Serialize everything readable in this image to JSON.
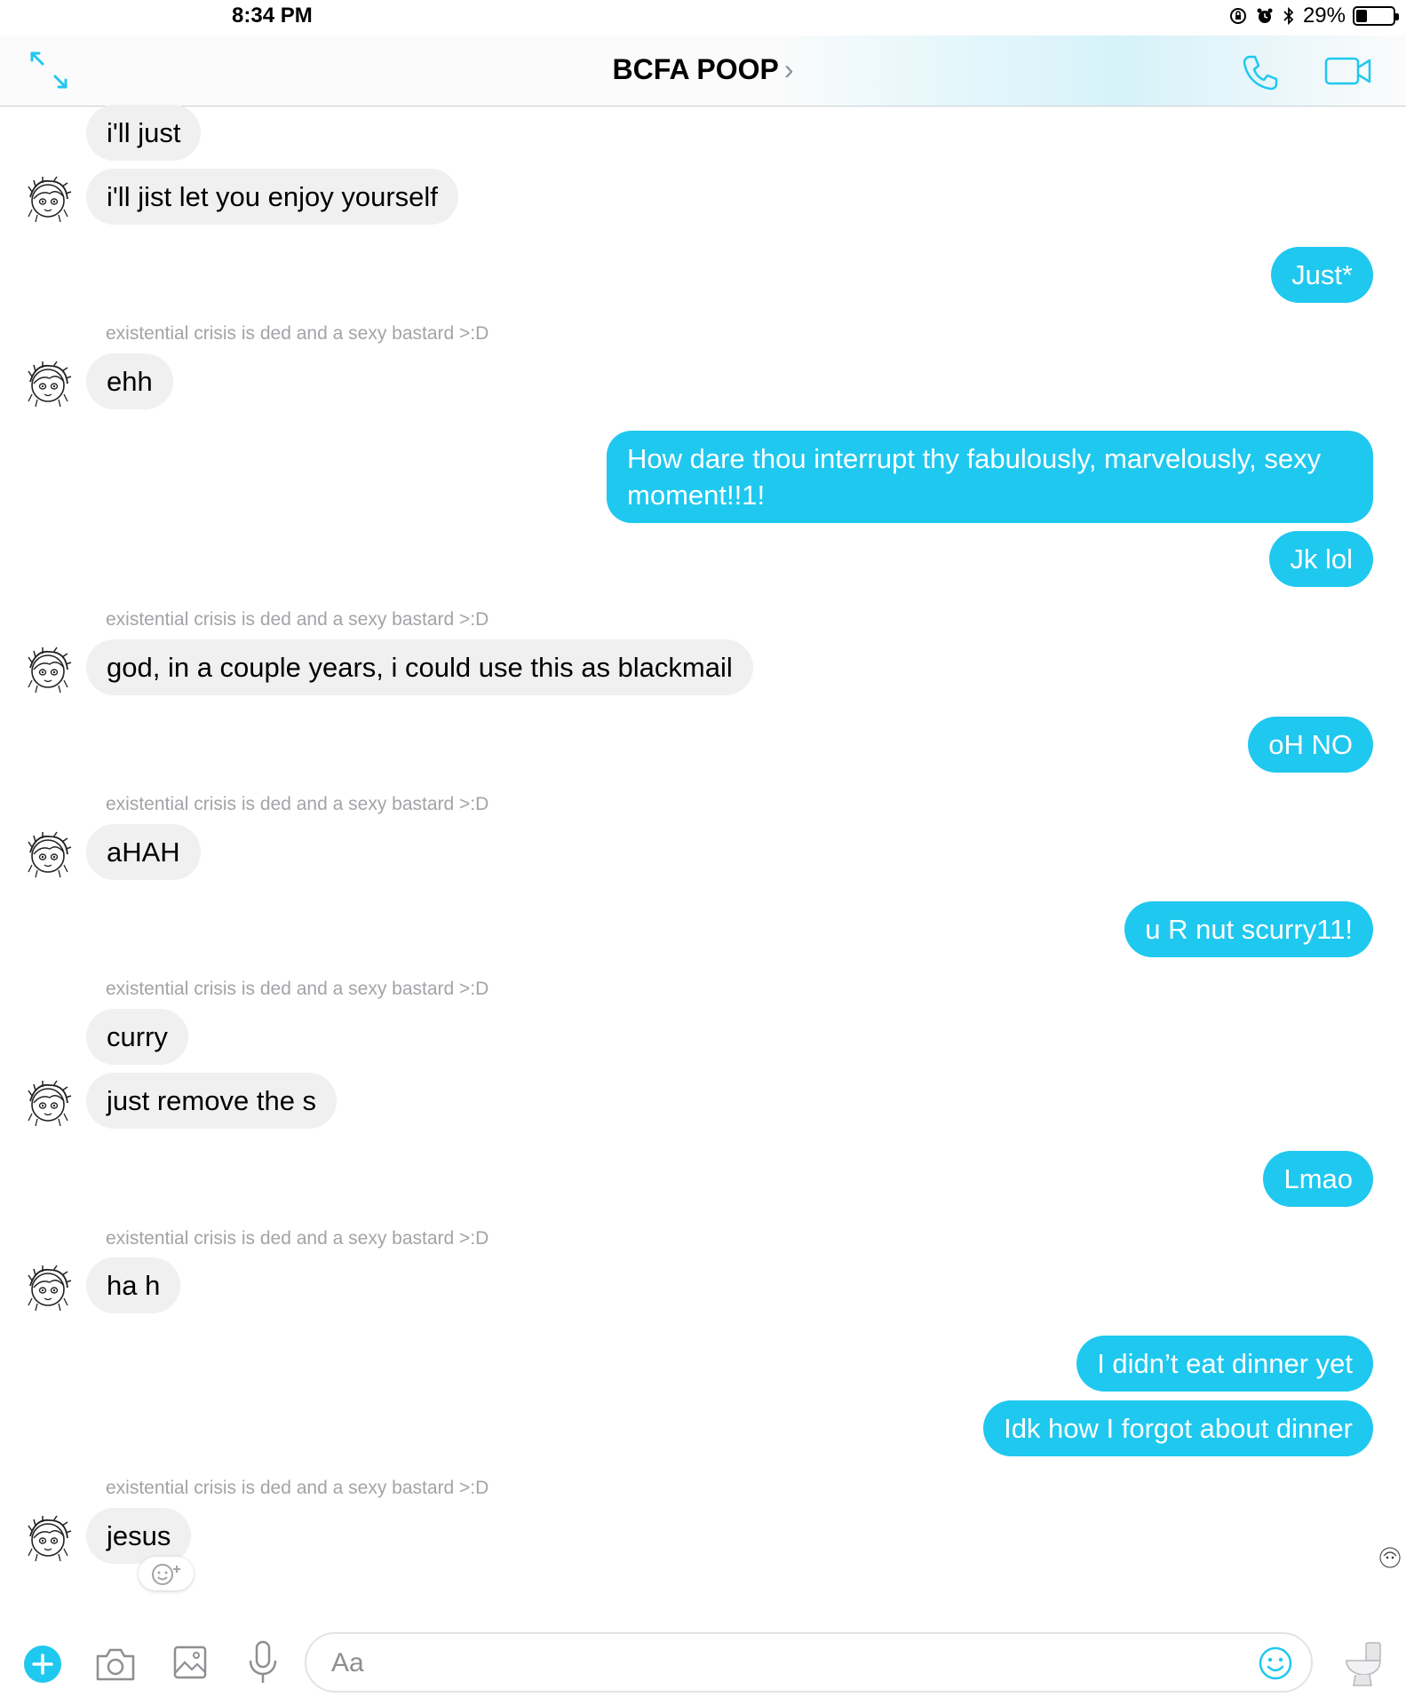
{
  "status_bar": {
    "time": "8:34 PM",
    "battery_percent": "29%",
    "battery_level": 0.29
  },
  "header": {
    "title": "BCFA POOP",
    "chevron": "›"
  },
  "thread": {
    "sender_name": "existential crisis is ded and a sexy bastard >:D",
    "messages": [
      {
        "dir": "in",
        "text": "i'll just"
      },
      {
        "dir": "in",
        "text": "i'll jist let you enjoy yourself"
      },
      {
        "dir": "out",
        "text": "Just*"
      },
      {
        "dir": "in",
        "text": "ehh"
      },
      {
        "dir": "out",
        "text": "How dare thou interrupt thy fabulously, marvelously, sexy moment!!1!"
      },
      {
        "dir": "out",
        "text": "Jk lol"
      },
      {
        "dir": "in",
        "text": "god, in a couple years, i could use this as blackmail"
      },
      {
        "dir": "out",
        "text": "oH NO"
      },
      {
        "dir": "in",
        "text": "aHAH"
      },
      {
        "dir": "out",
        "text": "u R nut scurry11!"
      },
      {
        "dir": "in",
        "text": "curry"
      },
      {
        "dir": "in",
        "text": "just remove the s"
      },
      {
        "dir": "out",
        "text": "Lmao"
      },
      {
        "dir": "in",
        "text": "ha h"
      },
      {
        "dir": "out",
        "text": "I didn’t eat dinner yet"
      },
      {
        "dir": "out",
        "text": "Idk how I forgot about dinner"
      },
      {
        "dir": "in",
        "text": "jesus"
      }
    ]
  },
  "composer": {
    "placeholder": "Aa"
  },
  "icons": {
    "expand": "expand-icon",
    "phone": "phone-icon",
    "video": "video-camera-icon",
    "plus": "plus-icon",
    "camera": "camera-icon",
    "gallery": "gallery-icon",
    "mic": "microphone-icon",
    "emoji": "emoji-icon",
    "quick_reaction": "toilet-icon",
    "add_reaction": "add-reaction-icon"
  },
  "colors": {
    "accent": "#1fc8ef",
    "incoming_bubble": "#f0f0f0",
    "meta_text": "#a3a3a8"
  }
}
